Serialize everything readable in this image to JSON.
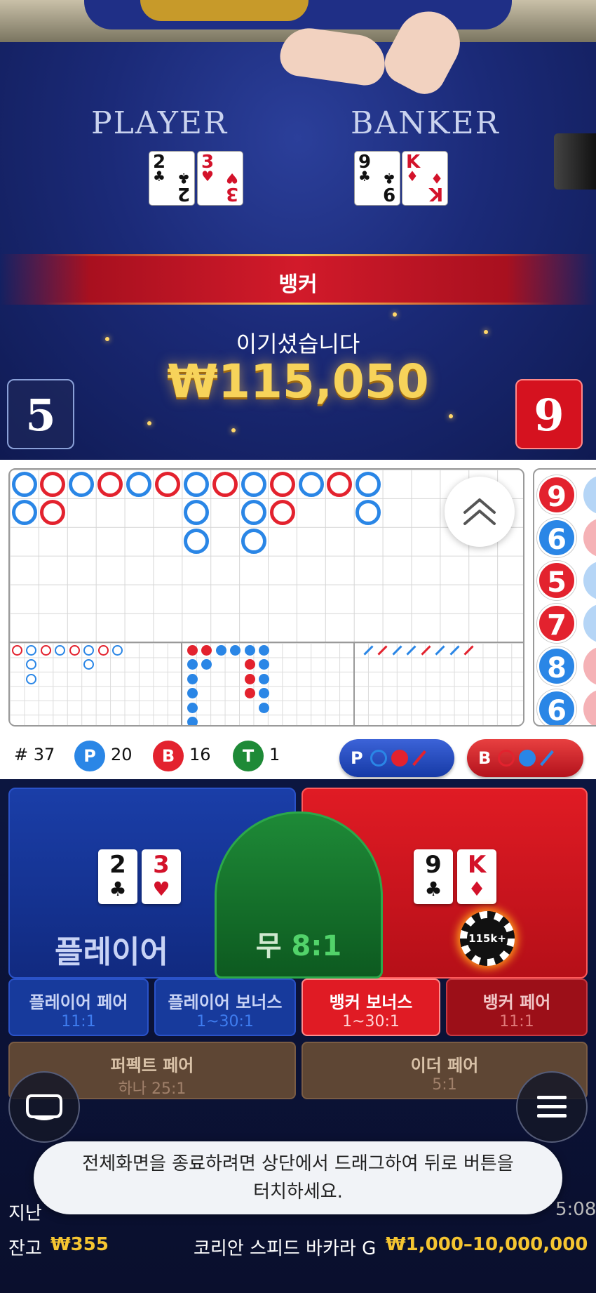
{
  "video": {
    "player_label": "PLAYER",
    "banker_label": "BANKER",
    "player_cards": [
      {
        "rank": "2",
        "suit": "♣"
      },
      {
        "rank": "3",
        "suit": "♥"
      }
    ],
    "banker_cards": [
      {
        "rank": "9",
        "suit": "♣"
      },
      {
        "rank": "K",
        "suit": "♦"
      }
    ],
    "result": "뱅커",
    "win_message": "이기셨습니다",
    "win_amount": "₩115,050",
    "player_score": "5",
    "banker_score": "9"
  },
  "roadmap": {
    "big_road": [
      [
        "P",
        "P"
      ],
      [
        "B",
        "B"
      ],
      [
        "P"
      ],
      [
        "B"
      ],
      [
        "P"
      ],
      [
        "B"
      ],
      [
        "P",
        "P",
        "P"
      ],
      [
        "B"
      ],
      [
        "P",
        "P",
        "P"
      ],
      [
        "B",
        "B"
      ],
      [
        "P"
      ],
      [
        "B"
      ],
      [
        "P",
        "P"
      ]
    ],
    "bead_plate": [
      {
        "value": "9",
        "side": "B"
      },
      {
        "value": "6",
        "side": "P"
      },
      {
        "value": "5",
        "side": "B"
      },
      {
        "value": "7",
        "side": "B"
      },
      {
        "value": "8",
        "side": "P"
      },
      {
        "value": "6",
        "side": "P"
      }
    ],
    "colors": {
      "player": "#2a86e6",
      "banker": "#e3222e",
      "tie": "#1e8a37"
    }
  },
  "stats": {
    "round": "# 37",
    "player_letter": "P",
    "player_count": "20",
    "banker_letter": "B",
    "banker_count": "16",
    "tie_letter": "T",
    "tie_count": "1",
    "ask_player": "P",
    "ask_banker": "B"
  },
  "bets": {
    "player_label": "플레이어",
    "player_cards": [
      {
        "rank": "2",
        "suit": "♣"
      },
      {
        "rank": "3",
        "suit": "♥"
      }
    ],
    "banker_cards": [
      {
        "rank": "9",
        "suit": "♣"
      },
      {
        "rank": "K",
        "suit": "♦"
      }
    ],
    "tie_label": "무",
    "tie_odds": "8:1",
    "chip": "115k+",
    "side_bets": {
      "player_pair": {
        "label": "플레이어 페어",
        "odds": "11:1"
      },
      "player_bonus": {
        "label": "플레이어 보너스",
        "odds": "1~30:1"
      },
      "banker_bonus": {
        "label": "뱅커 보너스",
        "odds": "1~30:1"
      },
      "banker_pair": {
        "label": "뱅커 페어",
        "odds": "11:1"
      },
      "perfect_pair": {
        "label": "퍼펙트 페어",
        "odds": "하나 25:1"
      },
      "either_pair": {
        "label": "이더 페어",
        "odds": "5:1"
      }
    }
  },
  "footer": {
    "last_win_prefix": "지난",
    "time_partial": "5:08",
    "balance_label": "잔고",
    "balance": "₩355",
    "table_name": "코리안 스피드 바카라 G",
    "limits": "₩1,000–10,000,000"
  },
  "toast": {
    "line1": "전체화면을 종료하려면 상단에서 드래그하여 뒤로 버튼을",
    "line2": "터치하세요."
  },
  "icons": {
    "collapse": "chevron-double-up-icon",
    "chat": "chat-bubble-icon",
    "menu": "hamburger-menu-icon"
  }
}
